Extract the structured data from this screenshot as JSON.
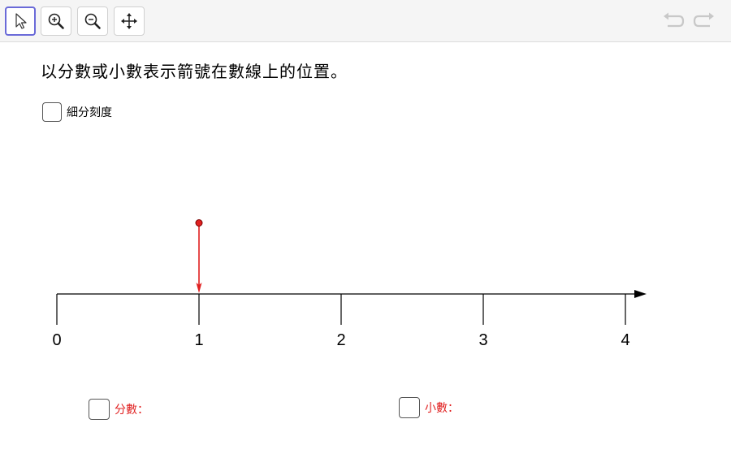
{
  "toolbar": {
    "tools": [
      {
        "name": "move-tool",
        "icon": "pointer-arrow-icon",
        "active": true
      },
      {
        "name": "zoom-in-tool",
        "icon": "zoom-in-icon",
        "active": false
      },
      {
        "name": "zoom-out-tool",
        "icon": "zoom-out-icon",
        "active": false
      },
      {
        "name": "pan-tool",
        "icon": "move-arrows-icon",
        "active": false
      }
    ],
    "undo_icon": "undo-icon",
    "redo_icon": "redo-icon"
  },
  "prompt": "以分數或小數表示箭號在數線上的位置。",
  "subdivide_checkbox": {
    "label": "細分刻度",
    "checked": false
  },
  "number_line": {
    "ticks": [
      "0",
      "1",
      "2",
      "3",
      "4"
    ],
    "arrow_position": 1,
    "axis_color": "#000000",
    "arrow_color": "#e02020"
  },
  "fraction_checkbox": {
    "label": "分數：",
    "checked": false,
    "color": "#e02020"
  },
  "decimal_checkbox": {
    "label": "小數：",
    "checked": false,
    "color": "#e02020"
  }
}
